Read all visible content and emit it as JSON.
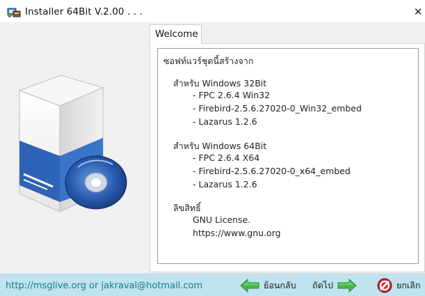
{
  "window": {
    "title": "Installer 64Bit V.2.00 . . .",
    "close_glyph": "✕",
    "icon": "installer-app-icon"
  },
  "tabs": [
    {
      "label": "Welcome",
      "selected": true
    }
  ],
  "content": {
    "lines": [
      "ซอฟท์แวร์ชุดนี้สร้างจาก",
      "สำหรับ Windows 32Bit",
      "- FPC 2.6.4 Win32",
      "- Firebird-2.5.6.27020-0_Win32_embed",
      "- Lazarus 1.2.6",
      "สำหรับ Windows 64Bit",
      "- FPC 2.6.4 X64",
      "- Firebird-2.5.6.27020-0_x64_embed",
      "- Lazarus 1.2.6",
      "ลิขสิทธิ์",
      "GNU License.",
      "https://www.gnu.org"
    ]
  },
  "footer": {
    "link_text": "http://msglive.org or jakraval@hotmail.com",
    "back_label": "ย้อนกลับ",
    "next_label": "ถัดไป",
    "cancel_label": "ยกเลิก"
  },
  "colors": {
    "footer_bg": "#bfe3ef",
    "link": "#1a7a8a",
    "arrow_green": "#49b84a",
    "cancel_red": "#d0202a",
    "box_blue": "#2e64b8",
    "disc_blue": "#1f4fa0"
  }
}
